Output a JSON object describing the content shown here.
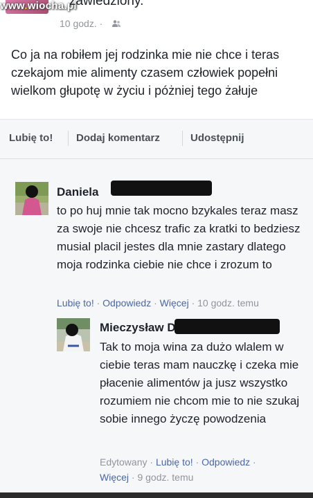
{
  "watermark": {
    "prefix": "www",
    "dot": ".",
    "name": "wiocha",
    "suffix": ".pl"
  },
  "post": {
    "title_fragment": "zawiedziony.",
    "time": "10 godz. ·",
    "text": "Co ja na robiłem jej rodzinka mie nie chce i teras czekajom mie alimenty czasem człowiek popełni wielkom głupotę w życiu i póżniej tego żałuje"
  },
  "actions": {
    "like": "Lubię to!",
    "comment": "Dodaj komentarz",
    "share": "Udostępnij"
  },
  "comments": [
    {
      "author": "Daniela",
      "text": "to po huj mnie tak mocno bzykales teraz masz za swoje nie chcesz trafic za kratki to bedziesz musial placil jestes dla mnie zastary dlatego moja rodzinka ciebie nie chce i zrozum to",
      "like": "Lubię to!",
      "sep1": " · ",
      "reply": "Odpowiedz",
      "sep2": " · ",
      "more": "Więcej",
      "time": " · 10 godz. temu"
    },
    {
      "author": "Mieczysław",
      "author_initial": "D",
      "text": "Tak to moja wina za dużo wlalem w ciebie teras mam nauczkę i czeka mie płacenie alimentów ja jusz wszystko rozumiem nie chcom mie to nie szukaj sobie innego życzę powodzenia",
      "edited": "Edytowany",
      "sep1": " · ",
      "like": "Lubię to!",
      "sep2": " · ",
      "reply": "Odpowiedz",
      "sep3": " ·",
      "more": "Więcej",
      "time": " · 9 godz. temu"
    }
  ],
  "colors": {
    "link": "#4b67a1",
    "meta": "#90949c",
    "text": "#1d2129",
    "bar_bg": "#f6f7f9"
  },
  "icons": [
    "audience-friends-icon"
  ]
}
